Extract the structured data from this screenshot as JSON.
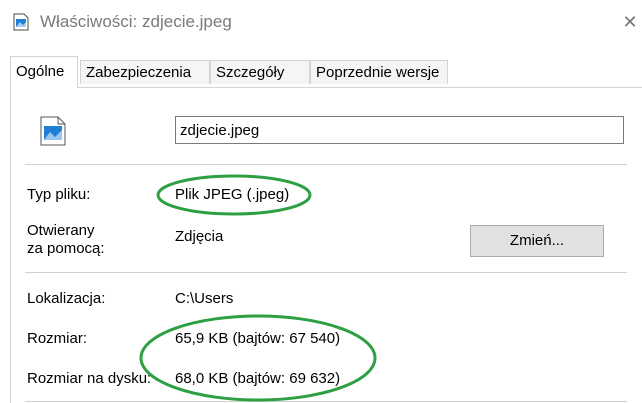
{
  "window": {
    "title": "Właściwości: zdjecie.jpeg",
    "close_glyph": "✕"
  },
  "tabs": [
    {
      "label": "Ogólne",
      "active": true
    },
    {
      "label": "Zabezpieczenia",
      "active": false
    },
    {
      "label": "Szczegóły",
      "active": false
    },
    {
      "label": "Poprzednie wersje",
      "active": false
    }
  ],
  "general": {
    "file_name": "zdjecie.jpeg",
    "file_type_label": "Typ pliku:",
    "file_type_value": "Plik JPEG (.jpeg)",
    "opens_with_label_line1": "Otwierany",
    "opens_with_label_line2": "za pomocą:",
    "opens_with_value": "Zdjęcia",
    "change_button": "Zmień...",
    "location_label": "Lokalizacja:",
    "location_value": "C:\\Users",
    "size_label": "Rozmiar:",
    "size_value": "65,9 KB (bajtów: 67 540)",
    "size_on_disk_label": "Rozmiar na dysku:",
    "size_on_disk_value": "68,0 KB (bajtów: 69 632)"
  },
  "colors": {
    "annotation": "#2ea043",
    "icon_blue": "#1f7fd6",
    "border": "#d4d4d4"
  },
  "icons": {
    "title": "image-file-icon",
    "file": "image-file-icon",
    "close": "close-icon"
  }
}
